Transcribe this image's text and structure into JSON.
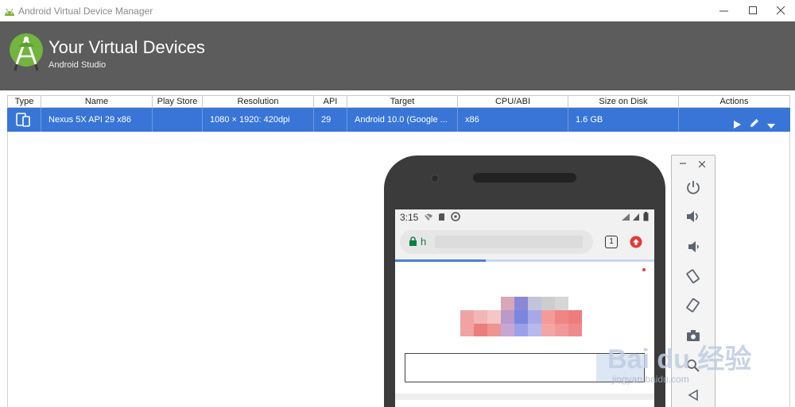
{
  "window": {
    "title": "Android Virtual Device Manager"
  },
  "header": {
    "title": "Your Virtual Devices",
    "subtitle": "Android Studio"
  },
  "table": {
    "columns": [
      "Type",
      "Name",
      "Play Store",
      "Resolution",
      "API",
      "Target",
      "CPU/ABI",
      "Size on Disk",
      "Actions"
    ],
    "rows": [
      {
        "type_icon": "device-phone-tablet-icon",
        "name": "Nexus 5X API 29 x86",
        "play_store": "",
        "resolution": "1080 × 1920: 420dpi",
        "api": "29",
        "target": "Android 10.0 (Google ...",
        "cpu_abi": "x86",
        "size": "1.6 GB",
        "actions": [
          "play-icon",
          "edit-pencil-icon",
          "dropdown-arrow-icon"
        ]
      }
    ]
  },
  "emulator": {
    "status_time": "3:15",
    "url_text": "h",
    "tab_count": "1",
    "page_load_progress": 0.35
  },
  "watermark": {
    "text": "Bai du 经验",
    "sub": "jingyan.baidu.com"
  },
  "colors": {
    "selection": "#3875d7",
    "banner": "#5c5c5c",
    "android_green": "#7cb342"
  }
}
